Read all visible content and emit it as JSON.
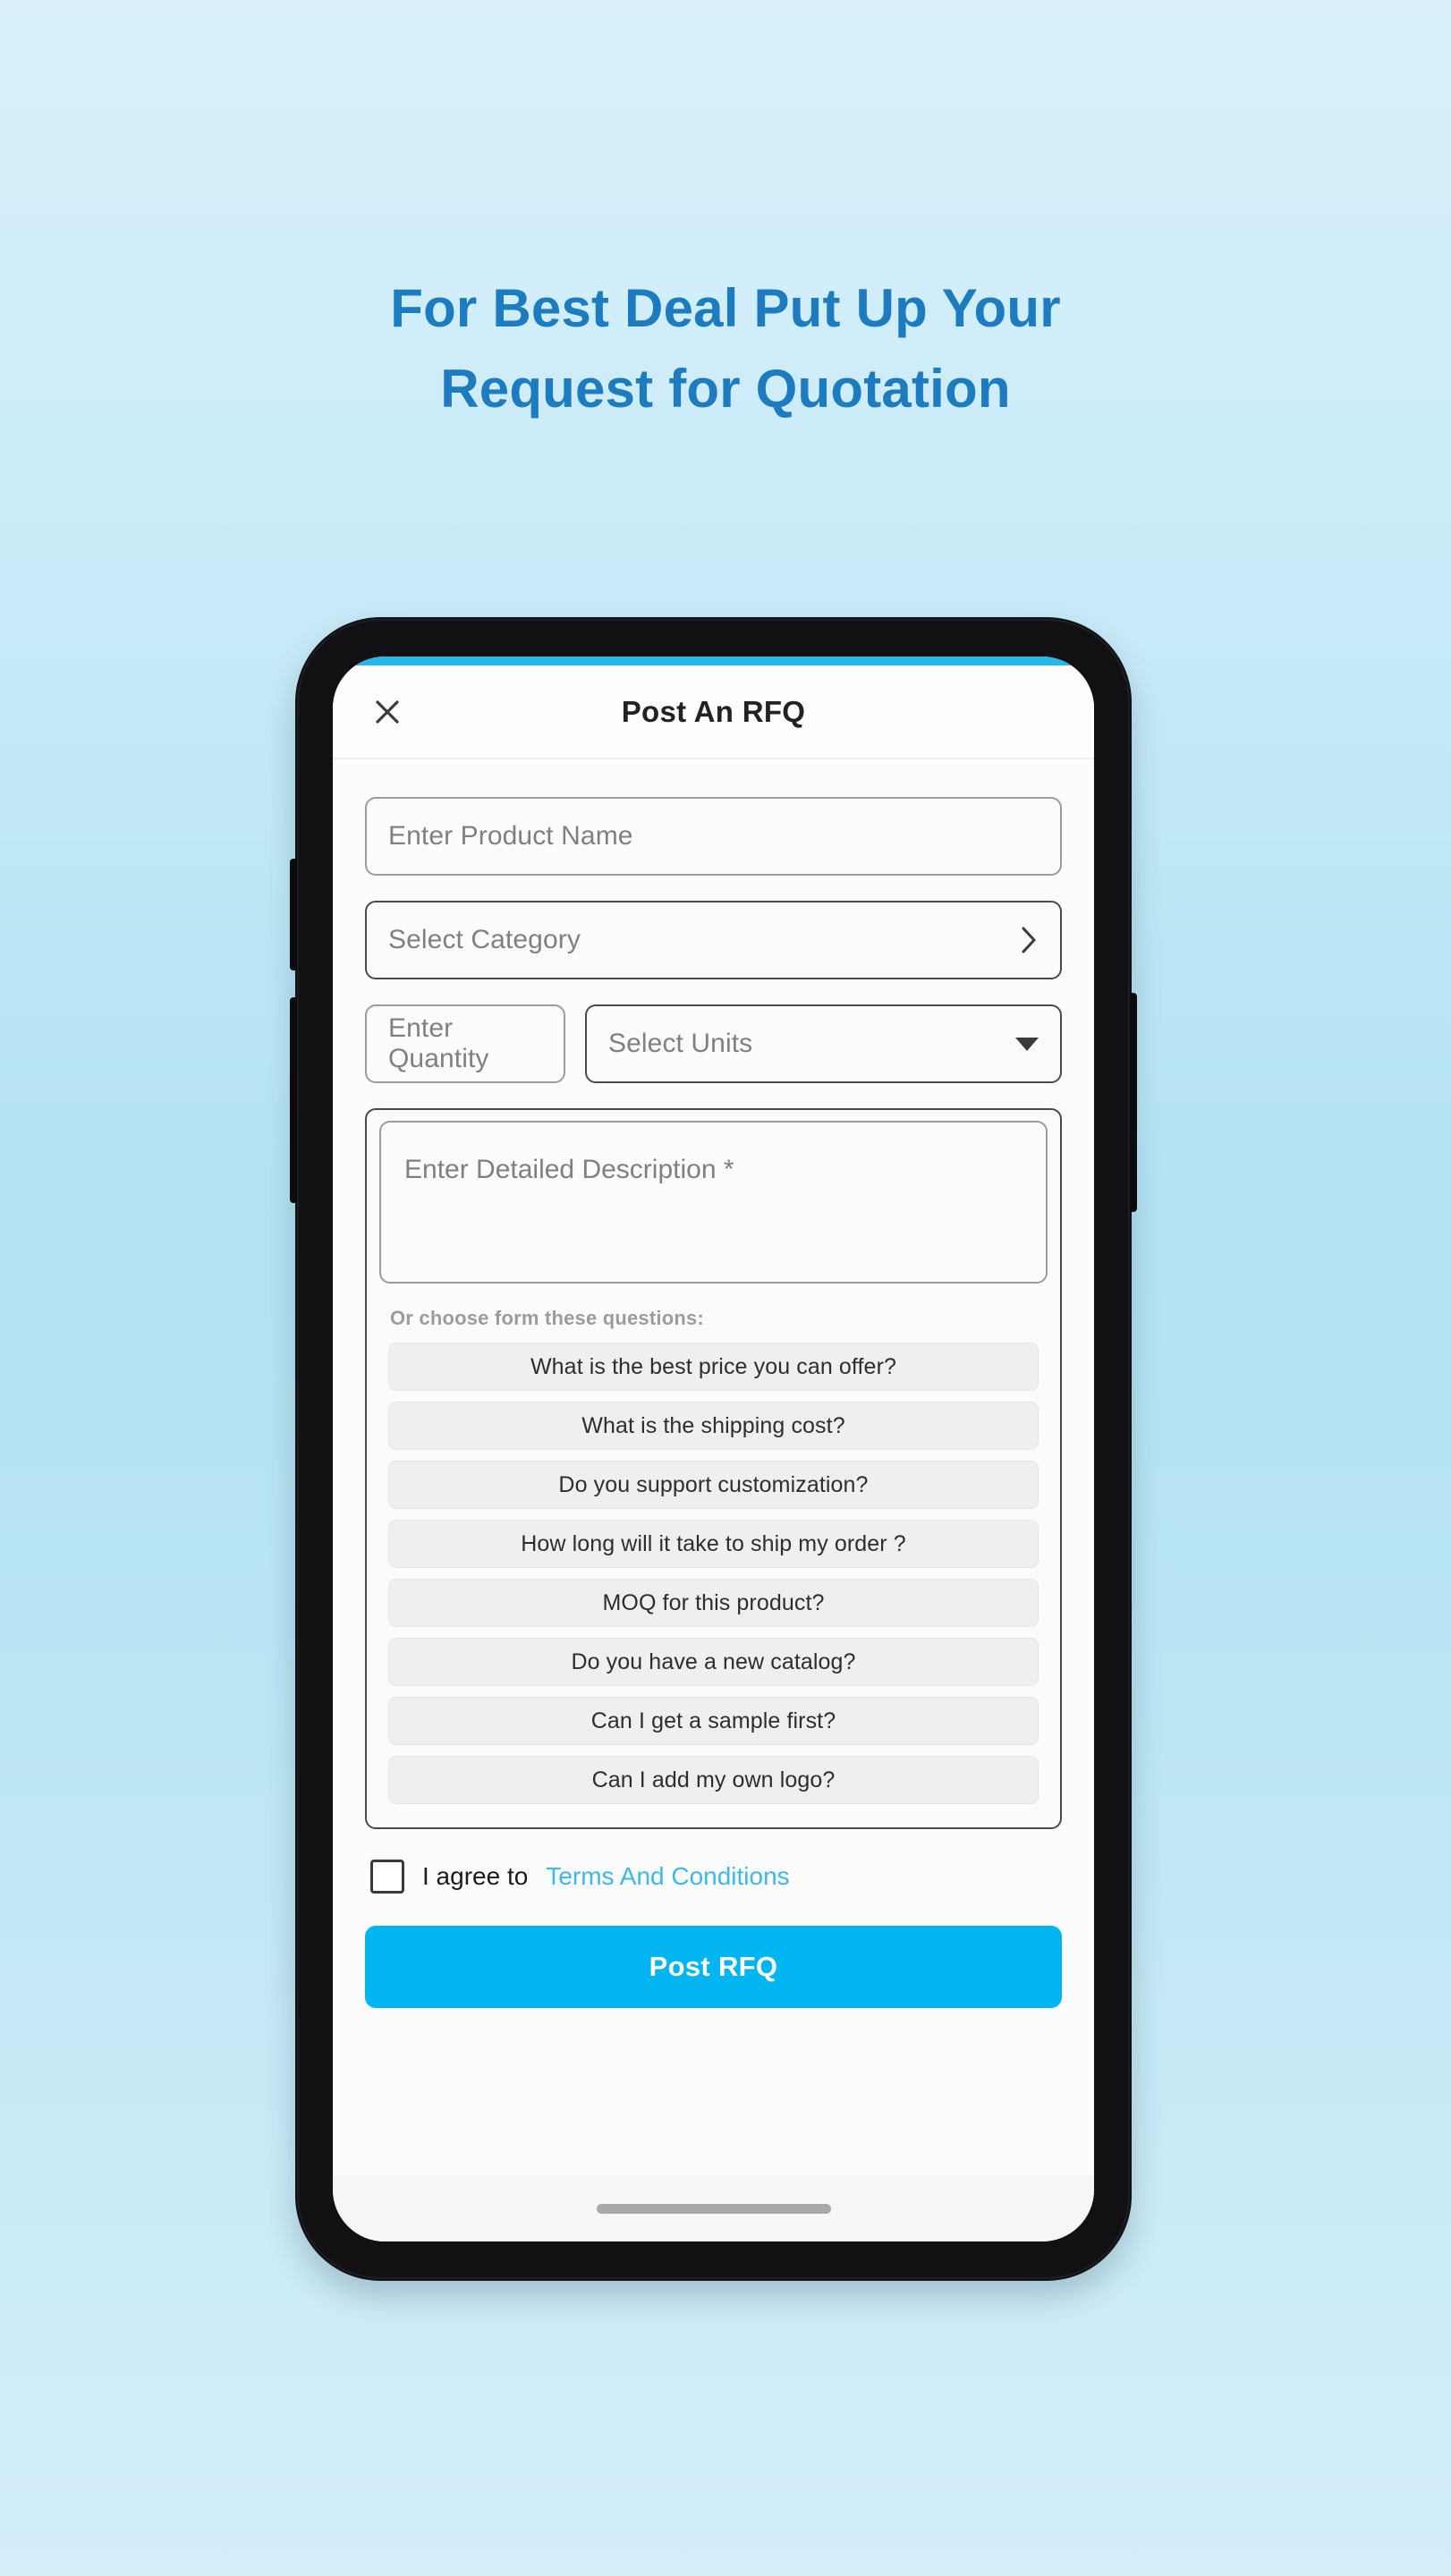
{
  "page": {
    "background_top": "#daf1fb",
    "background_mid": "#b4e3f3",
    "background_bottom": "#d4eefa"
  },
  "headline": {
    "color": "#1c7cbf",
    "line1": "For Best Deal Put Up Your",
    "line2": "Request for Quotation"
  },
  "phone": {
    "status_bar_color": "#29b6e8"
  },
  "app": {
    "header": {
      "close_icon": "close-icon",
      "title": "Post An RFQ"
    },
    "form": {
      "product_name": {
        "placeholder": "Enter Product Name"
      },
      "category": {
        "placeholder": "Select Category",
        "icon": "chevron-right-icon"
      },
      "quantity": {
        "placeholder": "Enter Quantity"
      },
      "units": {
        "placeholder": "Select Units",
        "icon": "caret-down-icon"
      },
      "description": {
        "placeholder": "Enter Detailed Description *"
      },
      "questions_label": "Or choose form these questions:",
      "questions": [
        "What is the best price you can offer?",
        "What is the shipping cost?",
        "Do you support customization?",
        "How long will it take to ship my order ?",
        "MOQ for this product?",
        "Do you have a new catalog?",
        "Can I get a sample first?",
        "Can I add my own logo?"
      ],
      "terms": {
        "checked": false,
        "text": "I agree to",
        "link": "Terms And Conditions",
        "link_color": "#3bb9e8"
      },
      "submit": {
        "label": "Post RFQ",
        "color": "#00b5f0"
      }
    }
  }
}
